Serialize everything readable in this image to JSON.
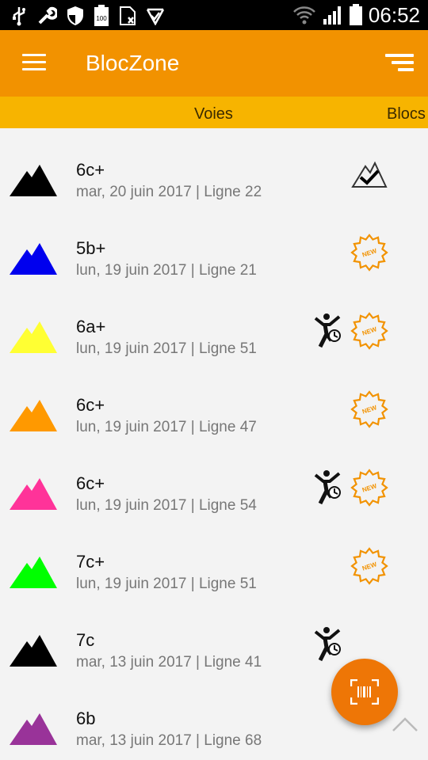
{
  "status_bar": {
    "time": "06:52",
    "icons": [
      "usb-icon",
      "wrench-icon",
      "shield-icon",
      "battery-100-icon",
      "sim-icon",
      "check-icon",
      "wifi-icon",
      "signal-icon",
      "battery-icon"
    ]
  },
  "app_bar": {
    "title": "BlocZone",
    "menu_icon": "menu-icon",
    "sort_icon": "sort-icon"
  },
  "tabs": [
    {
      "label": "Voies",
      "selected": true
    },
    {
      "label": "Blocs",
      "selected": false
    }
  ],
  "routes": [
    {
      "grade": "6c+",
      "subtitle": "mar, 20 juin 2017 | Ligne 22",
      "color": "#000000",
      "status": "completed",
      "climber": false
    },
    {
      "grade": "5b+",
      "subtitle": "lun, 19 juin 2017 | Ligne 21",
      "color": "#0000ee",
      "status": "new",
      "climber": false
    },
    {
      "grade": "6a+",
      "subtitle": "lun, 19 juin 2017 | Ligne 51",
      "color": "#ffff33",
      "status": "new",
      "climber": true
    },
    {
      "grade": "6c+",
      "subtitle": "lun, 19 juin 2017 | Ligne 47",
      "color": "#ff9900",
      "status": "new",
      "climber": false
    },
    {
      "grade": "6c+",
      "subtitle": "lun, 19 juin 2017 | Ligne 54",
      "color": "#ff3399",
      "status": "new",
      "climber": true
    },
    {
      "grade": "7c+",
      "subtitle": "lun, 19 juin 2017 | Ligne 51",
      "color": "#00ff00",
      "status": "new",
      "climber": false
    },
    {
      "grade": "7c",
      "subtitle": "mar, 13 juin 2017 | Ligne 41",
      "color": "#000000",
      "status": "none",
      "climber": true
    },
    {
      "grade": "6b",
      "subtitle": "mar, 13 juin 2017 | Ligne 68",
      "color": "#993399",
      "status": "none",
      "climber": false
    }
  ],
  "badge_text": "NEW",
  "colors": {
    "appbar": "#f29200",
    "tabs": "#f7b400",
    "fab": "#ee7606",
    "new_badge": "#f29200"
  },
  "fab": {
    "icon": "barcode-scan-icon"
  },
  "scroll_top_icon": "chevron-up-icon"
}
